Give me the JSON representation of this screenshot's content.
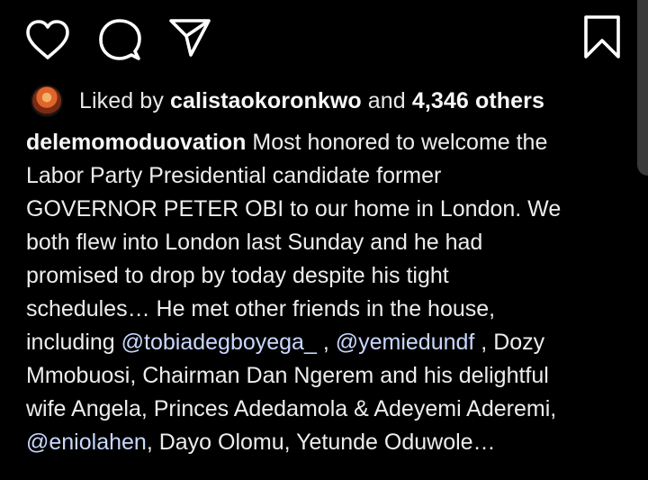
{
  "actions": {
    "like_icon": "heart-icon",
    "comment_icon": "comment-bubble-icon",
    "share_icon": "paper-plane-icon",
    "save_icon": "bookmark-icon"
  },
  "likes": {
    "prefix": "Liked by",
    "first_user": "calistaokoronkwo",
    "connector": "and",
    "others": "4,346 others"
  },
  "caption": {
    "username": "delemomoduovation",
    "lines": [
      [
        {
          "t": " Most honored to welcome the",
          "k": "text"
        }
      ],
      [
        {
          "t": "Labor Party Presidential candidate former",
          "k": "text"
        }
      ],
      [
        {
          "t": "GOVERNOR PETER OBI to our home in London. We",
          "k": "text"
        }
      ],
      [
        {
          "t": "both flew into London last Sunday and he had",
          "k": "text"
        }
      ],
      [
        {
          "t": "promised to drop by today despite his tight",
          "k": "text"
        }
      ],
      [
        {
          "t": "schedules… He met other friends in the house,",
          "k": "text"
        }
      ],
      [
        {
          "t": "including ",
          "k": "text"
        },
        {
          "t": "@tobiadegboyega_",
          "k": "mention"
        },
        {
          "t": " , ",
          "k": "text"
        },
        {
          "t": "@yemiedundf",
          "k": "mention"
        },
        {
          "t": " , Dozy",
          "k": "text"
        }
      ],
      [
        {
          "t": "Mmobuosi, Chairman Dan Ngerem and his delightful",
          "k": "text"
        }
      ],
      [
        {
          "t": "wife Angela, Princes Adedamola & Adeyemi Aderemi,",
          "k": "text"
        }
      ],
      [
        {
          "t": "@eniolahen",
          "k": "mention"
        },
        {
          "t": ", Dayo Olomu, Yetunde Oduwole…",
          "k": "text"
        }
      ]
    ]
  }
}
